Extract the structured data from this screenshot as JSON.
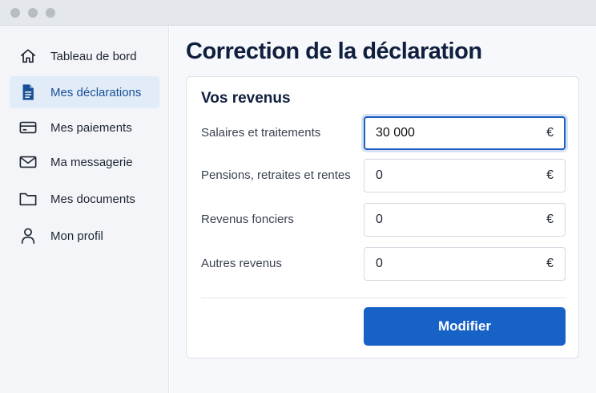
{
  "sidebar": {
    "items": [
      {
        "label": "Tableau de bord",
        "icon": "home-icon",
        "active": false
      },
      {
        "label": "Mes déclarations",
        "icon": "document-icon",
        "active": true
      },
      {
        "label": "Mes paiements",
        "icon": "credit-card-icon",
        "active": false
      },
      {
        "label": "Ma messagerie",
        "icon": "mail-icon",
        "active": false
      },
      {
        "label": "Mes documents",
        "icon": "folder-icon",
        "active": false
      },
      {
        "label": "Mon profil",
        "icon": "user-icon",
        "active": false
      }
    ]
  },
  "main": {
    "title": "Correction de la déclaration",
    "section": {
      "title": "Vos revenus",
      "fields": [
        {
          "label": "Salaires et traitements",
          "value": "30 000",
          "unit": "€",
          "focused": true
        },
        {
          "label": "Pensions, retraites et rentes",
          "value": "0",
          "unit": "€",
          "focused": false
        },
        {
          "label": "Revenus fonciers",
          "value": "0",
          "unit": "€",
          "focused": false
        },
        {
          "label": "Autres revenus",
          "value": "0",
          "unit": "€",
          "focused": false
        }
      ]
    },
    "submit_label": "Modifier"
  },
  "colors": {
    "accent": "#1762c7",
    "active_nav_bg": "#e1ecf8",
    "title": "#0f1f3d"
  }
}
